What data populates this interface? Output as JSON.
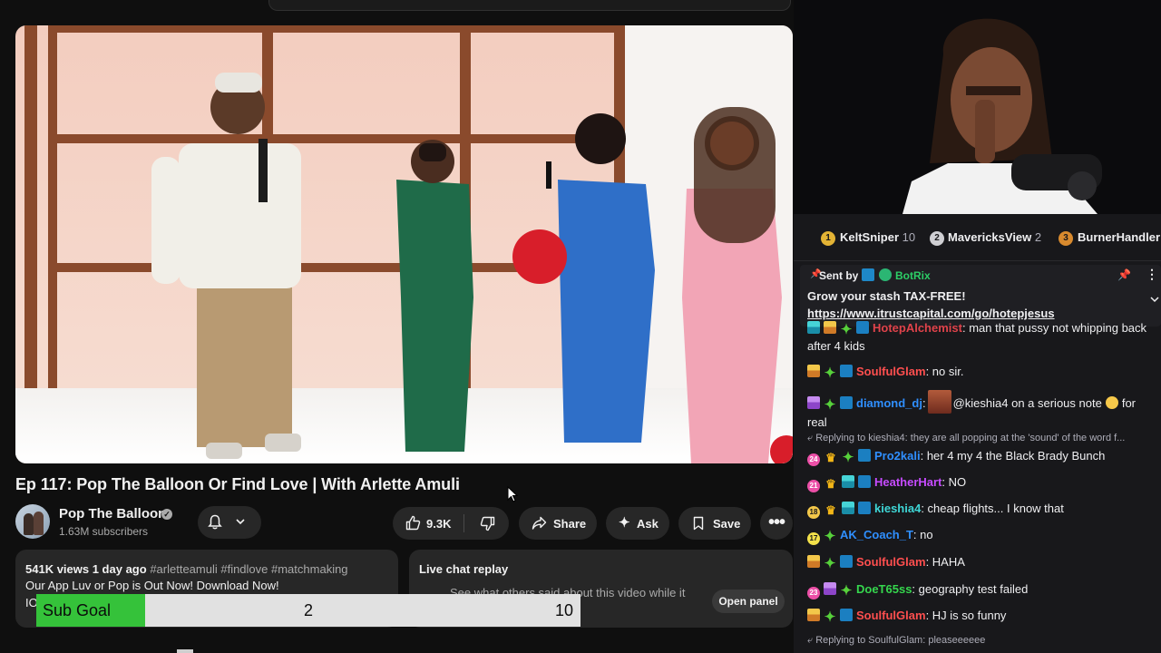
{
  "video": {
    "title": "Ep 117: Pop The Balloon Or Find Love | With Arlette Amuli",
    "channel": {
      "name": "Pop The Balloon",
      "subscribers": "1.63M subscribers"
    },
    "actions": {
      "likes": "9.3K",
      "share_label": "Share",
      "ask_label": "Ask",
      "save_label": "Save"
    },
    "description": {
      "views_date": "541K views  1 day ago",
      "tags": "#arletteamuli #findlove #matchmaking",
      "line1": "Our App Luv or Pop is Out Now! Download Now!",
      "line2": "IO"
    },
    "live_chat_replay": {
      "title": "Live chat replay",
      "text": "See what others said about this video while it",
      "open_panel_label": "Open panel"
    }
  },
  "overlay": {
    "sub_goal": {
      "label": "Sub Goal",
      "current": "2",
      "target": "10",
      "progress": 0.2
    }
  },
  "chat": {
    "leaderboard": [
      {
        "rank": "1",
        "name": "KeltSniper",
        "count": "10"
      },
      {
        "rank": "2",
        "name": "MavericksView",
        "count": "2"
      },
      {
        "rank": "3",
        "name": "BurnerHandler",
        "count": ""
      }
    ],
    "pinned": {
      "sent_by_label": "Sent by",
      "author": "BotRix",
      "message": "Grow your stash TAX-FREE!",
      "link": "https://www.itrustcapital.com/go/hotepjesus"
    },
    "messages": [
      {
        "user": "HotepAlchemist",
        "user_color": "#e0434b",
        "text": ": man that pussy not whipping back after 4 kids"
      },
      {
        "user": "SoulfulGlam",
        "user_color": "#ff4f4f",
        "text": ": no sir."
      },
      {
        "user": "diamond_dj",
        "user_color": "#2f8fff",
        "text_a": "@kieshia4 on a serious note",
        "text_b": "for real"
      },
      {
        "reply": "Replying to kieshia4: they are all popping at the 'sound' of the word f..."
      },
      {
        "badge": "24",
        "user": "Pro2kali",
        "user_color": "#2f8fff",
        "text": ": her 4 my 4 the Black Brady Bunch"
      },
      {
        "badge": "21",
        "user": "HeatherHart",
        "user_color": "#c64bff",
        "text": ": NO"
      },
      {
        "badge": "18",
        "user": "kieshia4",
        "user_color": "#3ed6d6",
        "text": ": cheap flights... I know that"
      },
      {
        "badge": "17",
        "user": "AK_Coach_T",
        "user_color": "#2f8fff",
        "text": ": no"
      },
      {
        "user": "SoulfulGlam",
        "user_color": "#ff4f4f",
        "text": ": HAHA"
      },
      {
        "badge": "23",
        "user": "DoeT65ss",
        "user_color": "#35d64d",
        "text": ": geography test failed"
      },
      {
        "user": "SoulfulGlam",
        "user_color": "#ff4f4f",
        "text": ": HJ is so funny"
      },
      {
        "reply": "Replying to SoulfulGlam: pleaseeeeee"
      }
    ]
  },
  "colors": {
    "youtube_bg": "#0f0f0f",
    "pill_bg": "#272727",
    "twitch_chat_bg": "#18181b",
    "sub_goal_fill": "#35c23a"
  }
}
